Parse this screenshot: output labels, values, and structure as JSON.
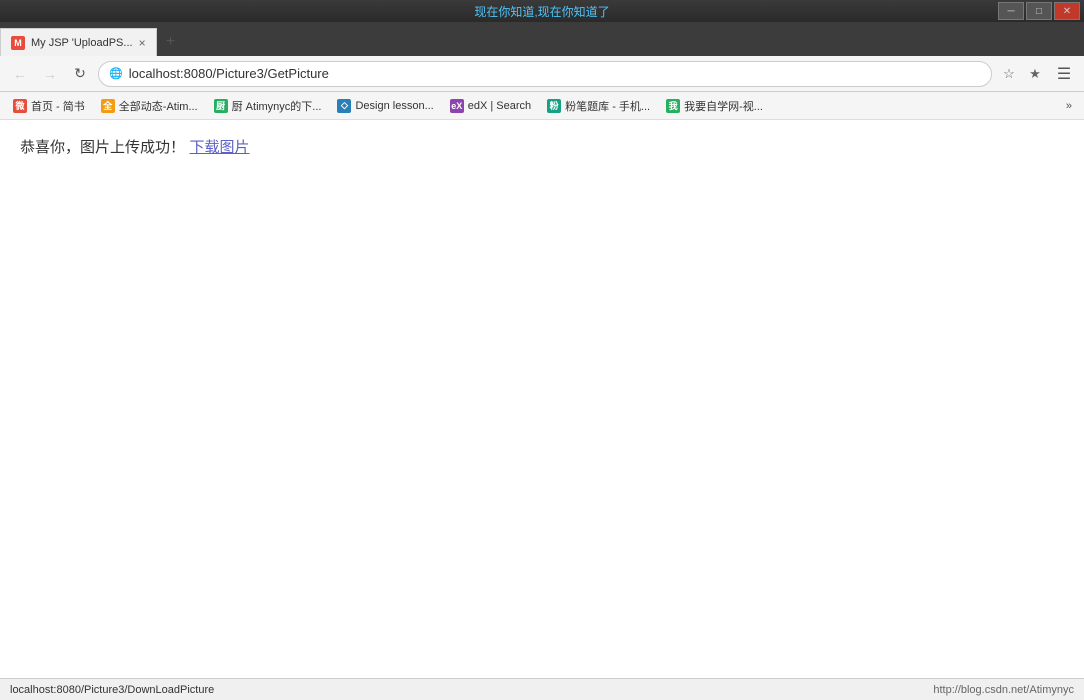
{
  "window": {
    "top_title": "现在你知道,现在你知道了",
    "controls": {
      "minimize": "─",
      "maximize": "□",
      "close": "✕"
    }
  },
  "tab": {
    "icon_text": "M",
    "label": "My JSP 'UploadPS...",
    "close": "×"
  },
  "address_bar": {
    "url": "localhost:8080/Picture3/GetPicture",
    "back_disabled": true,
    "forward_disabled": true
  },
  "bookmarks": [
    {
      "icon": "微",
      "icon_class": "red",
      "label": "首页 - 简书"
    },
    {
      "icon": "全",
      "icon_class": "orange",
      "label": "全部动态-Atim..."
    },
    {
      "icon": "厨",
      "icon_class": "green",
      "label": "厨 Atimynyc的下..."
    },
    {
      "icon": "◇",
      "icon_class": "blue",
      "label": "Design lesson..."
    },
    {
      "icon": "edX",
      "icon_class": "purple",
      "label": "edX | Search"
    },
    {
      "icon": "粉",
      "icon_class": "teal",
      "label": "粉笔题库 - 手机..."
    },
    {
      "icon": "我",
      "icon_class": "green",
      "label": "我要自学网-视..."
    }
  ],
  "bookmarks_more": "»",
  "page": {
    "success_text": "恭喜你，图片上传成功！",
    "download_link_text": "下载图片"
  },
  "status_bar": {
    "left": "localhost:8080/Picture3/DownLoadPicture",
    "right": "http://blog.csdn.net/Atimynyc"
  }
}
